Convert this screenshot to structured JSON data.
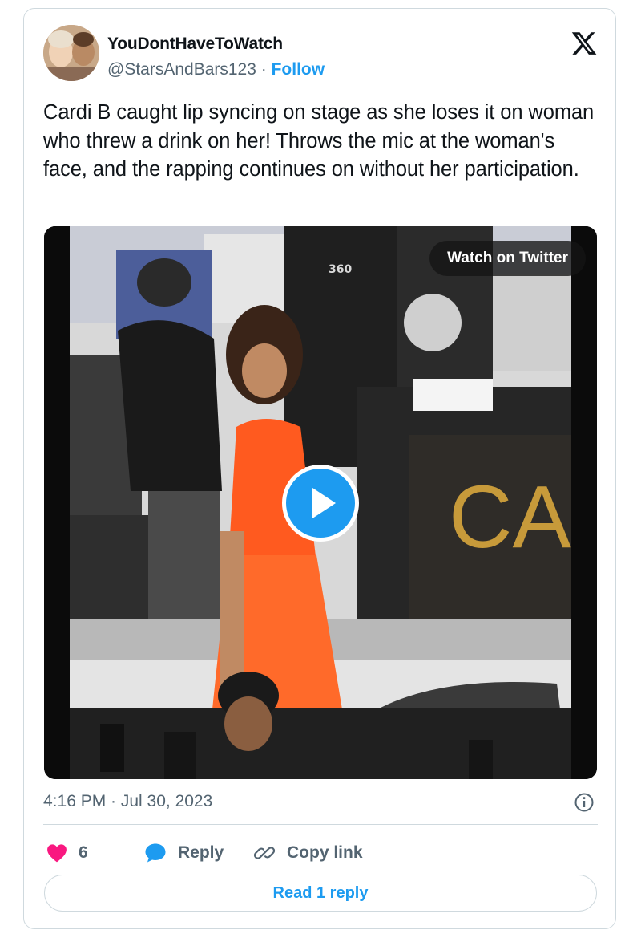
{
  "tweet": {
    "author": {
      "display_name": "YouDontHaveToWatch",
      "handle": "@StarsAndBars123",
      "separator": " · ",
      "follow_label": "Follow"
    },
    "text": "Cardi B caught lip syncing on stage as she loses it on woman who threw a drink on her!  Throws the mic at the woman's face, and the rapping continues on without her participation.",
    "media": {
      "watch_label": "Watch on Twitter",
      "overlay_texts": {
        "shirt_logo": "360",
        "sign": "CA"
      }
    },
    "timestamp": "4:16 PM · Jul 30, 2023",
    "like_count": "6",
    "reply_label": "Reply",
    "copy_link_label": "Copy link",
    "read_replies_label": "Read 1 reply"
  },
  "colors": {
    "accent": "#1d9bf0",
    "like": "#f91880",
    "muted": "#536471",
    "border": "#cfd9de"
  },
  "icons": [
    "x-logo-icon",
    "play-icon",
    "info-icon",
    "heart-icon",
    "reply-bubble-icon",
    "link-icon"
  ]
}
